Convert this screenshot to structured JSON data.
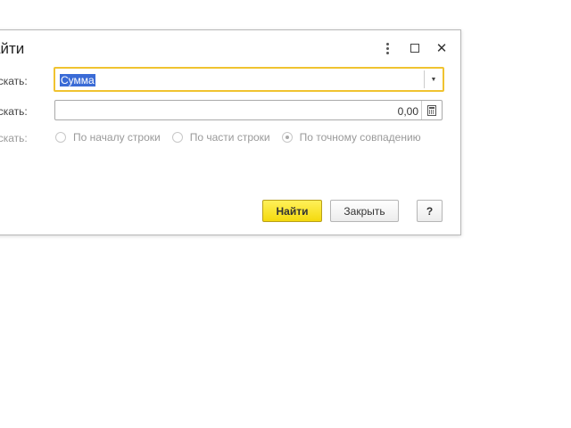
{
  "dialog": {
    "title": "айти",
    "controls": {
      "more_icon": "more-vertical-icon",
      "maximize_icon": "maximize-icon",
      "close_icon": "close-icon",
      "close_glyph": "✕"
    }
  },
  "fields": {
    "where_label": "искать:",
    "where_value": "Сумма",
    "what_label": "искать:",
    "what_value": "0,00",
    "how_label": "искать:"
  },
  "radios": [
    {
      "label": "По началу строки",
      "checked": false
    },
    {
      "label": "По части строки",
      "checked": false
    },
    {
      "label": "По точному совпадению",
      "checked": true
    }
  ],
  "buttons": {
    "find": "Найти",
    "close": "Закрыть",
    "help": "?"
  },
  "colors": {
    "focus_border": "#f0c330",
    "primary_button": "#f4d90d",
    "selection": "#3a6bd6"
  }
}
